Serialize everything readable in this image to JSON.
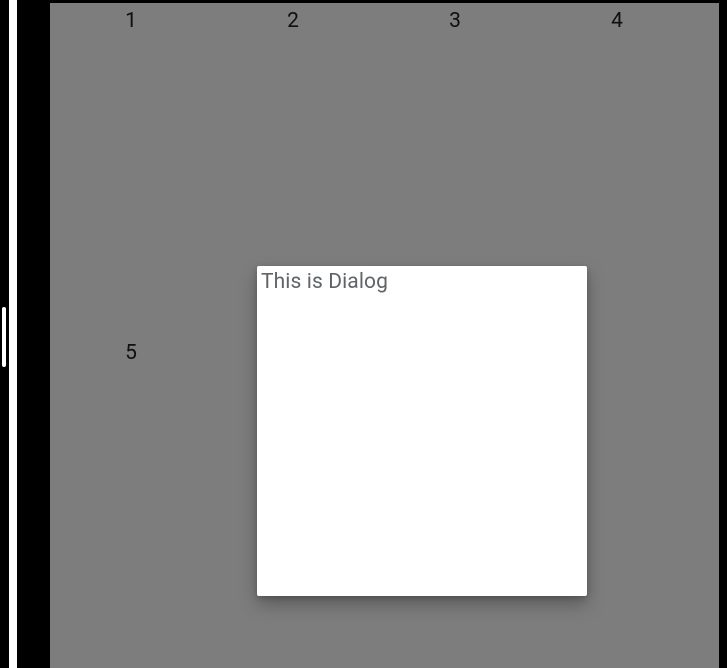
{
  "grid": {
    "row1": [
      {
        "label": "1"
      },
      {
        "label": "2"
      },
      {
        "label": "3"
      },
      {
        "label": "4"
      }
    ],
    "row2": [
      {
        "label": "5"
      }
    ]
  },
  "dialog": {
    "title": "This is Dialog"
  }
}
